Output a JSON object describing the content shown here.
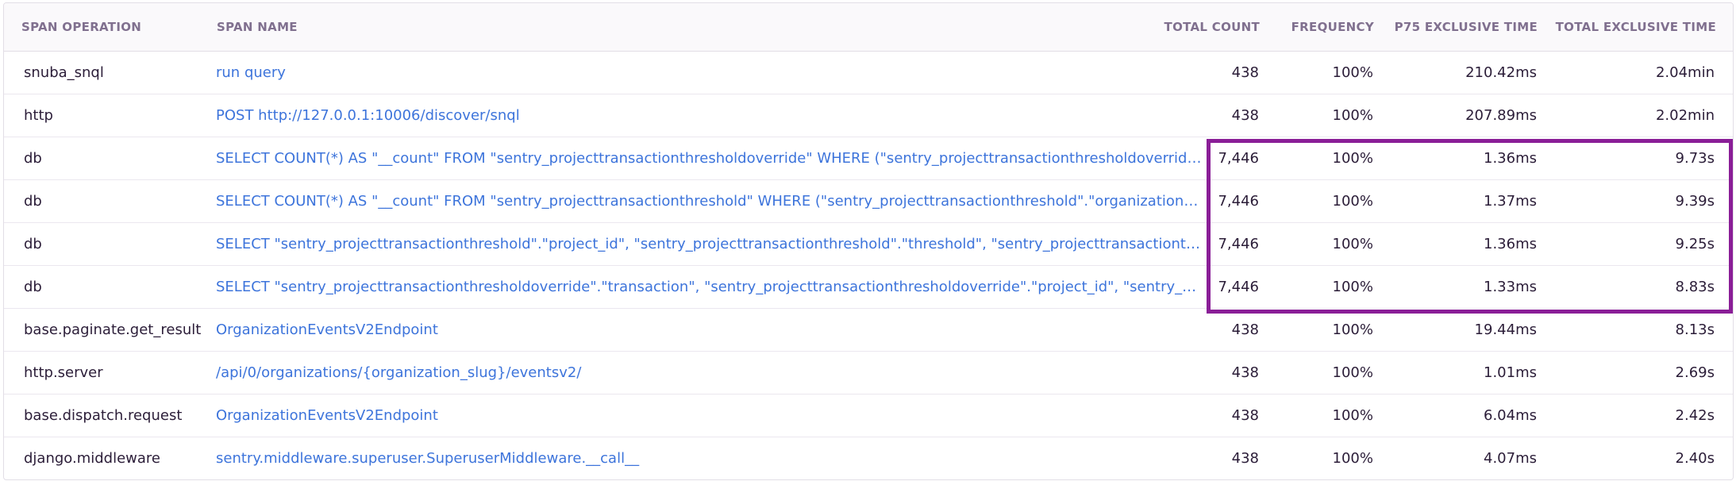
{
  "table": {
    "headers": {
      "span_operation": "SPAN OPERATION",
      "span_name": "SPAN NAME",
      "total_count": "TOTAL COUNT",
      "frequency": "FREQUENCY",
      "p75_exclusive_time": "P75 EXCLUSIVE TIME",
      "total_exclusive_time": "TOTAL EXCLUSIVE TIME"
    },
    "rows": [
      {
        "op": "snuba_snql",
        "name": "run query",
        "count": "438",
        "freq": "100%",
        "p75": "210.42ms",
        "total": "2.04min"
      },
      {
        "op": "http",
        "name": "POST http://127.0.0.1:10006/discover/snql",
        "count": "438",
        "freq": "100%",
        "p75": "207.89ms",
        "total": "2.02min"
      },
      {
        "op": "db",
        "name": "SELECT COUNT(*) AS \"__count\" FROM \"sentry_projecttransactionthresholdoverride\" WHERE (\"sentry_projecttransactionthresholdoverride\".\"organization_id\" = %s AND \"sentry_projecttransactionthresholdoverride\".\"project_id\" IN (%s))",
        "count": "7,446",
        "freq": "100%",
        "p75": "1.36ms",
        "total": "9.73s"
      },
      {
        "op": "db",
        "name": "SELECT COUNT(*) AS \"__count\" FROM \"sentry_projecttransactionthreshold\" WHERE (\"sentry_projecttransactionthreshold\".\"organization_id\" = %s AND \"sentry_projecttransactionthreshold\".\"project_id\" IN (%s))",
        "count": "7,446",
        "freq": "100%",
        "p75": "1.37ms",
        "total": "9.39s"
      },
      {
        "op": "db",
        "name": "SELECT \"sentry_projecttransactionthreshold\".\"project_id\", \"sentry_projecttransactionthreshold\".\"threshold\", \"sentry_projecttransactionthreshold\".\"metric\" FROM \"sentry_projecttransactionthreshold\"",
        "count": "7,446",
        "freq": "100%",
        "p75": "1.36ms",
        "total": "9.25s"
      },
      {
        "op": "db",
        "name": "SELECT \"sentry_projecttransactionthresholdoverride\".\"transaction\", \"sentry_projecttransactionthresholdoverride\".\"project_id\", \"sentry_projecttransactionthresholdoverride\".\"threshold\"",
        "count": "7,446",
        "freq": "100%",
        "p75": "1.33ms",
        "total": "8.83s"
      },
      {
        "op": "base.paginate.get_result",
        "name": "OrganizationEventsV2Endpoint",
        "count": "438",
        "freq": "100%",
        "p75": "19.44ms",
        "total": "8.13s"
      },
      {
        "op": "http.server",
        "name": "/api/0/organizations/{organization_slug}/eventsv2/",
        "count": "438",
        "freq": "100%",
        "p75": "1.01ms",
        "total": "2.69s"
      },
      {
        "op": "base.dispatch.request",
        "name": "OrganizationEventsV2Endpoint",
        "count": "438",
        "freq": "100%",
        "p75": "6.04ms",
        "total": "2.42s"
      },
      {
        "op": "django.middleware",
        "name": "sentry.middleware.superuser.SuperuserMiddleware.__call__",
        "count": "438",
        "freq": "100%",
        "p75": "4.07ms",
        "total": "2.40s"
      }
    ]
  },
  "colors": {
    "link": "#3d74db",
    "text": "#2b1d38",
    "header_text": "#80708f",
    "highlight": "#8a1e97"
  }
}
